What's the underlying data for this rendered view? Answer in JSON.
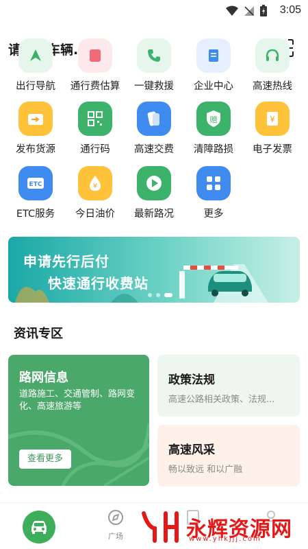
{
  "status_bar": {
    "time": "3:05"
  },
  "header": {
    "vehicle_label": "请绑定车辆...",
    "caret": "▼"
  },
  "grid": [
    [
      {
        "label": "出行导航",
        "icon": "navigation-icon",
        "color": "#3cb26a",
        "bg": "#e6f6ec"
      },
      {
        "label": "通行费估算",
        "icon": "calculator-icon",
        "color": "#f06a7a",
        "bg": "#fde9ec"
      },
      {
        "label": "一键救援",
        "icon": "phone-icon",
        "color": "#3cb26a",
        "bg": "#e6f6ec"
      },
      {
        "label": "企业中心",
        "icon": "document-icon",
        "color": "#3f8bf0",
        "bg": "#e6f0fd"
      },
      {
        "label": "高速热线",
        "icon": "headset-icon",
        "color": "#3cb26a",
        "bg": "#e6f6ec"
      }
    ],
    [
      {
        "label": "发布货源",
        "icon": "cargo-icon",
        "color": "#f5a21c",
        "bg": "#fec33a"
      },
      {
        "label": "通行码",
        "icon": "qr-code-icon",
        "color": "#3cb26a",
        "bg": "#3cb26a"
      },
      {
        "label": "高速交费",
        "icon": "card-icon",
        "color": "#3f8bf0",
        "bg": "#3f8bf0"
      },
      {
        "label": "清障路损",
        "icon": "shield-icon",
        "color": "#3cb26a",
        "bg": "#3cb26a"
      },
      {
        "label": "电子发票",
        "icon": "invoice-icon",
        "color": "#f5a21c",
        "bg": "#fec33a"
      }
    ],
    [
      {
        "label": "ETC服务",
        "icon": "etc-icon",
        "color": "#3f8bf0",
        "bg": "#3f8bf0"
      },
      {
        "label": "今日油价",
        "icon": "oil-drop-icon",
        "color": "#f5a21c",
        "bg": "#fec33a"
      },
      {
        "label": "最新路况",
        "icon": "play-icon",
        "color": "#3cb26a",
        "bg": "#3cb26a"
      },
      {
        "label": "更多",
        "icon": "more-icon",
        "color": "#3f8bf0",
        "bg": "#3f8bf0"
      }
    ]
  ],
  "etc_badge": "ETC",
  "shield_char": "赔",
  "yen_char": "¥",
  "banner": {
    "line1": "申请先行后付",
    "line2": "快速通行收费站"
  },
  "section_title": "资讯专区",
  "cards": {
    "road": {
      "title": "路网信息",
      "desc": "道路施工、交通管制、路网变化、高速旅游等",
      "button": "查看更多"
    },
    "policy": {
      "title": "政策法规",
      "desc": "高速公路相关政策、法规..."
    },
    "scenery": {
      "title": "高速风采",
      "desc": "畅以致远 和以广融"
    }
  },
  "bottom_nav": {
    "square_label": "广场",
    "accent": "#3cae5c"
  },
  "watermark": {
    "text": "永辉资源网",
    "url": "www.yhkjjj.com"
  }
}
